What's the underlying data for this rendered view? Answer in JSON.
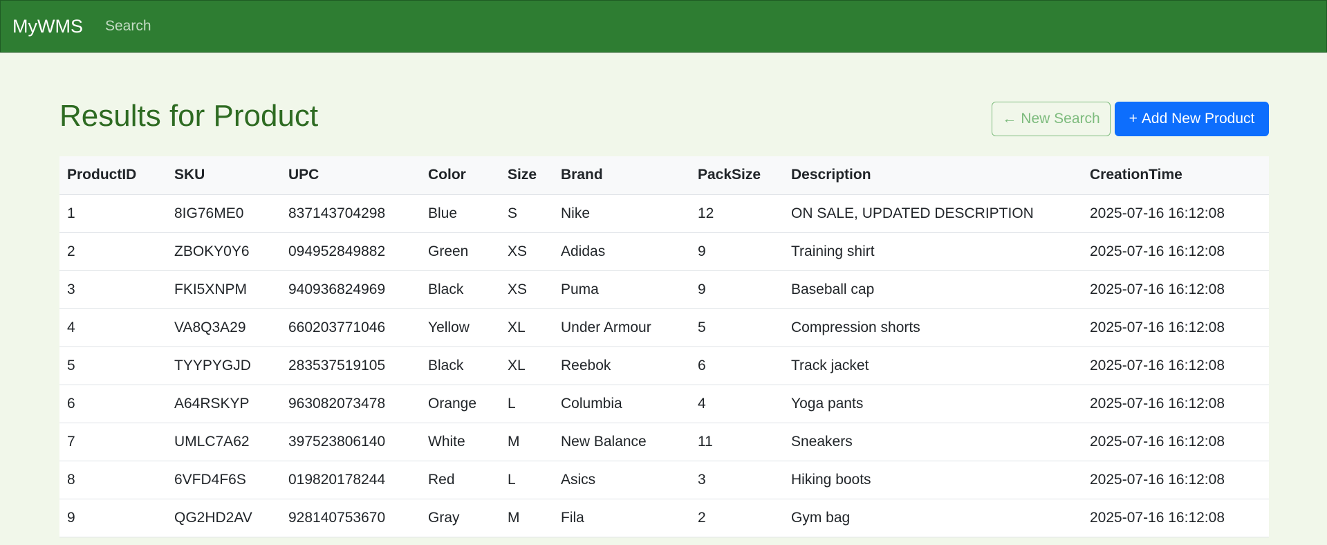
{
  "navbar": {
    "brand": "MyWMS",
    "search_link": "Search",
    "color": "#2e7d32"
  },
  "page": {
    "title": "Results for Product",
    "new_search_label": "New Search",
    "new_search_icon": "left-arrow-icon",
    "add_product_label": "Add New Product",
    "add_product_icon": "plus-icon",
    "accent_color": "#0d6efd",
    "title_color": "#2e6b22"
  },
  "table": {
    "columns": [
      "ProductID",
      "SKU",
      "UPC",
      "Color",
      "Size",
      "Brand",
      "PackSize",
      "Description",
      "CreationTime"
    ],
    "rows": [
      [
        "1",
        "8IG76ME0",
        "837143704298",
        "Blue",
        "S",
        "Nike",
        "12",
        "ON SALE, UPDATED DESCRIPTION",
        "2025-07-16 16:12:08"
      ],
      [
        "2",
        "ZBOKY0Y6",
        "094952849882",
        "Green",
        "XS",
        "Adidas",
        "9",
        "Training shirt",
        "2025-07-16 16:12:08"
      ],
      [
        "3",
        "FKI5XNPM",
        "940936824969",
        "Black",
        "XS",
        "Puma",
        "9",
        "Baseball cap",
        "2025-07-16 16:12:08"
      ],
      [
        "4",
        "VA8Q3A29",
        "660203771046",
        "Yellow",
        "XL",
        "Under Armour",
        "5",
        "Compression shorts",
        "2025-07-16 16:12:08"
      ],
      [
        "5",
        "TYYPYGJD",
        "283537519105",
        "Black",
        "XL",
        "Reebok",
        "6",
        "Track jacket",
        "2025-07-16 16:12:08"
      ],
      [
        "6",
        "A64RSKYP",
        "963082073478",
        "Orange",
        "L",
        "Columbia",
        "4",
        "Yoga pants",
        "2025-07-16 16:12:08"
      ],
      [
        "7",
        "UMLC7A62",
        "397523806140",
        "White",
        "M",
        "New Balance",
        "11",
        "Sneakers",
        "2025-07-16 16:12:08"
      ],
      [
        "8",
        "6VFD4F6S",
        "019820178244",
        "Red",
        "L",
        "Asics",
        "3",
        "Hiking boots",
        "2025-07-16 16:12:08"
      ],
      [
        "9",
        "QG2HD2AV",
        "928140753670",
        "Gray",
        "M",
        "Fila",
        "2",
        "Gym bag",
        "2025-07-16 16:12:08"
      ]
    ]
  }
}
